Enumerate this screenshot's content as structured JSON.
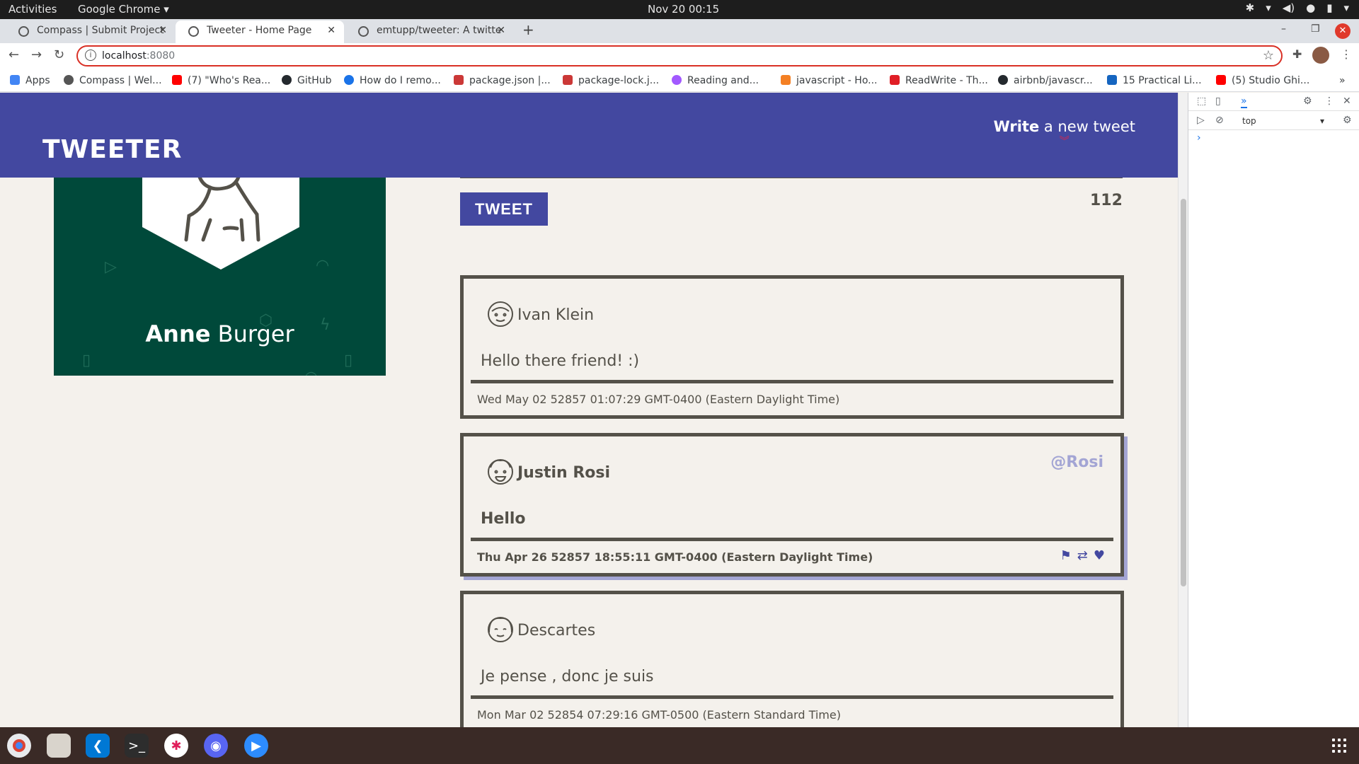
{
  "system": {
    "activities": "Activities",
    "app_menu": "Google Chrome ▾",
    "clock": "Nov 20  00:15"
  },
  "browser": {
    "tabs": [
      {
        "title": "Compass | Submit Project",
        "active": false
      },
      {
        "title": "Tweeter - Home Page",
        "active": true
      },
      {
        "title": "emtupp/tweeter: A twitte",
        "active": false
      }
    ],
    "url_host": "localhost",
    "url_port": ":8080",
    "bookmarks": [
      {
        "label": "Apps",
        "color": "#4285f4"
      },
      {
        "label": "Compass | Wel...",
        "color": "#555555"
      },
      {
        "label": "(7) \"Who's Rea...",
        "color": "#ff0000"
      },
      {
        "label": "GitHub",
        "color": "#24292e"
      },
      {
        "label": "How do I remo...",
        "color": "#1a73e8"
      },
      {
        "label": "package.json |...",
        "color": "#cb3837"
      },
      {
        "label": "package-lock.j...",
        "color": "#cb3837"
      },
      {
        "label": "Reading and...",
        "color": "#a259ff"
      },
      {
        "label": "javascript - Ho...",
        "color": "#f48024"
      },
      {
        "label": "ReadWrite - Th...",
        "color": "#e01e26"
      },
      {
        "label": "airbnb/javascr...",
        "color": "#24292e"
      },
      {
        "label": "15 Practical Li...",
        "color": "#1565c0"
      },
      {
        "label": "(5) Studio Ghi...",
        "color": "#ff0000"
      }
    ],
    "bookmarks_more": "»"
  },
  "site": {
    "logo": "TWEETER",
    "compose_bold": "Write",
    "compose_rest": " a new tweet",
    "compose_chevron": "︾",
    "profile_first": "Anne",
    "profile_last": " Burger",
    "tweet_button": "TWEET",
    "char_counter": "112"
  },
  "tweets": [
    {
      "name": "Ivan Klein",
      "handle": "",
      "text": "Hello there friend! :)",
      "date": "Wed May 02 52857 01:07:29 GMT-0400 (Eastern Daylight Time)",
      "hover": false
    },
    {
      "name": "Justin Rosi",
      "handle": "@Rosi",
      "text": "Hello",
      "date": "Thu Apr 26 52857 18:55:11 GMT-0400 (Eastern Daylight Time)",
      "hover": true
    },
    {
      "name": "Descartes",
      "handle": "",
      "text": "Je pense , donc je suis",
      "date": "Mon Mar 02 52854 07:29:16 GMT-0500 (Eastern Standard Time)",
      "hover": false
    }
  ],
  "devtools": {
    "more_tabs": "»",
    "context": "top",
    "console_prompt": "›"
  },
  "colors": {
    "nav": "#4348a0",
    "profile_bg": "#00493a",
    "page_bg": "#f4f1ec",
    "text": "#545149",
    "accent_light": "#a3a5d4",
    "chevron": "#d7264d"
  }
}
